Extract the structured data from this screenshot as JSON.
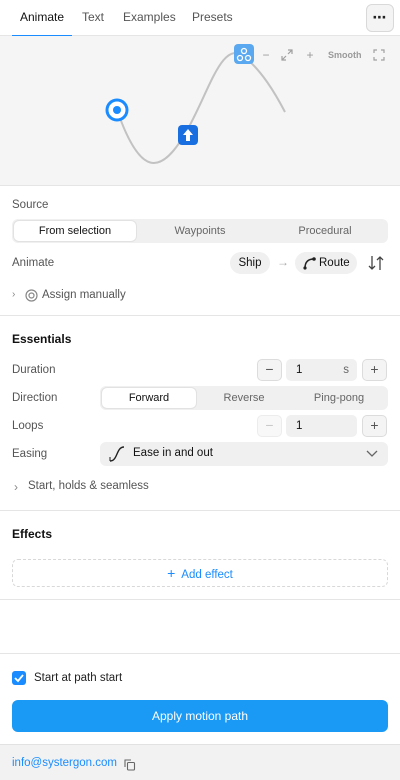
{
  "tabs": [
    {
      "label": "Animate",
      "active": true
    },
    {
      "label": "Text",
      "active": false
    },
    {
      "label": "Examples",
      "active": false
    },
    {
      "label": "Presets",
      "active": false
    }
  ],
  "more_button": "⋯",
  "preview": {
    "smooth_label": "Smooth",
    "toolbar_icons": [
      "path-tool-icon",
      "zoom-out-icon",
      "expand-icon",
      "zoom-in-icon",
      "fullscreen-icon"
    ],
    "accent": "#1a8cff"
  },
  "source": {
    "label": "Source",
    "options": [
      "From selection",
      "Waypoints",
      "Procedural"
    ],
    "selected": "From selection"
  },
  "animate": {
    "label": "Animate",
    "from": "Ship",
    "to": "Route"
  },
  "assign_manually": "Assign manually",
  "essentials": {
    "title": "Essentials",
    "duration": {
      "label": "Duration",
      "value": "1",
      "unit": "s"
    },
    "direction": {
      "label": "Direction",
      "options": [
        "Forward",
        "Reverse",
        "Ping-pong"
      ],
      "selected": "Forward"
    },
    "loops": {
      "label": "Loops",
      "value": "1"
    },
    "easing": {
      "label": "Easing",
      "value": "Ease in and out"
    },
    "start_holds": "Start, holds & seamless"
  },
  "effects": {
    "title": "Effects",
    "add_effect": "Add effect"
  },
  "start_at_path_start": {
    "label": "Start at path start",
    "checked": true
  },
  "apply_button": "Apply motion path",
  "footer": {
    "email": "info@systergon.com"
  }
}
